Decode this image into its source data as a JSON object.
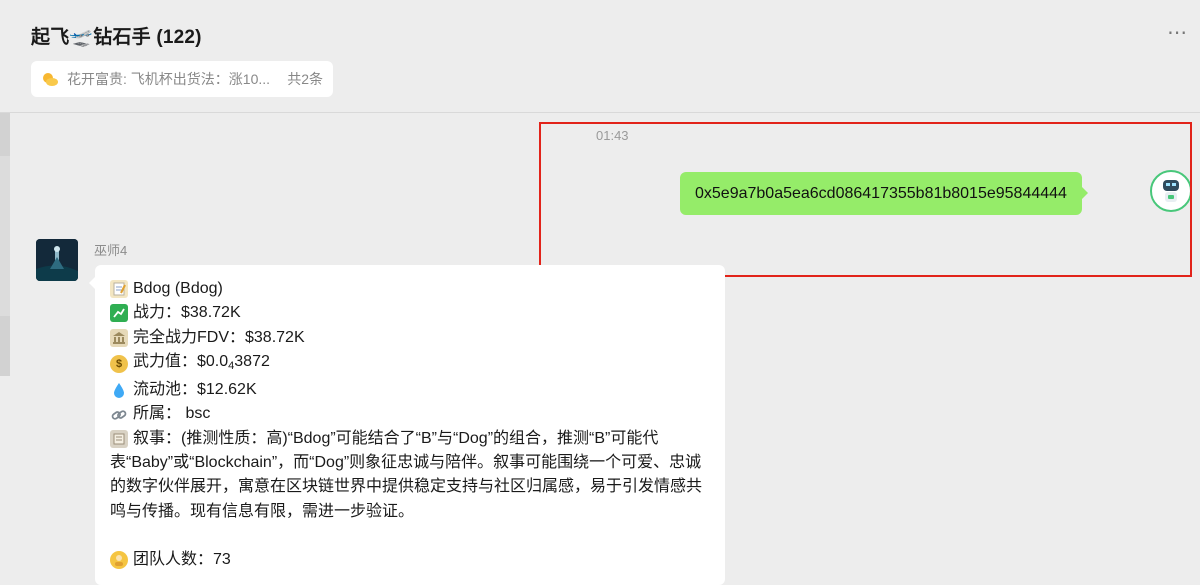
{
  "header": {
    "title": "起飞🛫钻石手 (122)",
    "pinned_text": "花开富贵: 飞机杯出货法：涨10...",
    "pinned_count": "共2条"
  },
  "messages": {
    "sent": {
      "time": "01:43",
      "text": "0x5e9a7b0a5ea6cd086417355b81b8015e95844444"
    },
    "received": {
      "sender": "巫师4",
      "name_line": "Bdog (Bdog)",
      "combat": "战力：$38.72K",
      "fdv": "完全战力FDV：$38.72K",
      "force_prefix": "武力值：$0.0",
      "force_sub": "4",
      "force_suffix": "3872",
      "pool": "流动池：$12.62K",
      "chain": "所属：  bsc",
      "narrative": "叙事：(推测性质：高)“Bdog”可能结合了“B”与“Dog”的组合，推测“B”可能代表“Baby”或“Blockchain”，而“Dog”则象征忠诚与陪伴。叙事可能围绕一个可爱、忠诚的数字伙伴展开，寓意在区块链世界中提供稳定支持与社区归属感，易于引发情感共鸣与传播。现有信息有限，需进一步验证。",
      "team": "团队人数：73"
    }
  },
  "icons": {
    "pinned": "sun-cloud-icon",
    "memo": "memo-icon",
    "chart": "chart-icon",
    "bank": "bank-icon",
    "money_bag": "money-bag-icon",
    "droplet": "droplet-icon",
    "link": "link-icon",
    "scroll": "scroll-icon",
    "person": "person-icon"
  },
  "colors": {
    "sent_bubble": "#95ec69",
    "highlight_border": "#e2231a",
    "background": "#ededed"
  }
}
